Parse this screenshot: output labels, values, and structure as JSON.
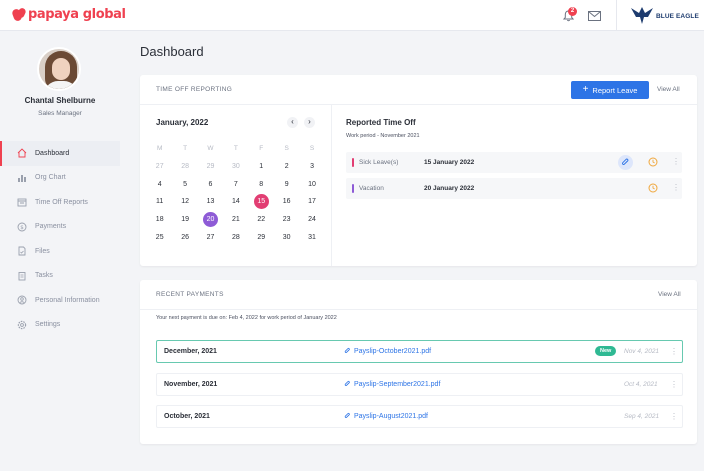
{
  "brand": {
    "name": "papaya global",
    "color": "#ef4150"
  },
  "header": {
    "notification_count": "2",
    "company_name": "BLUE EAGLE"
  },
  "user": {
    "name": "Chantal Shelburne",
    "role": "Sales Manager"
  },
  "sidebar": {
    "items": [
      {
        "label": "Dashboard",
        "icon": "home-icon",
        "active": true
      },
      {
        "label": "Org Chart",
        "icon": "org-chart-icon"
      },
      {
        "label": "Time Off Reports",
        "icon": "time-off-icon"
      },
      {
        "label": "Payments",
        "icon": "dollar-icon"
      },
      {
        "label": "Files",
        "icon": "file-icon"
      },
      {
        "label": "Tasks",
        "icon": "clipboard-icon"
      },
      {
        "label": "Personal Information",
        "icon": "person-icon"
      },
      {
        "label": "Settings",
        "icon": "gear-icon"
      }
    ]
  },
  "page_title": "Dashboard",
  "time_off": {
    "section_title": "TIME OFF REPORTING",
    "report_button": "Report Leave",
    "view_all": "View All",
    "calendar": {
      "month_label": "January, 2022",
      "prev": "‹",
      "next": "›",
      "weekdays": [
        "M",
        "T",
        "W",
        "T",
        "F",
        "S",
        "S"
      ],
      "days": [
        {
          "d": "27",
          "muted": true
        },
        {
          "d": "28",
          "muted": true
        },
        {
          "d": "29",
          "muted": true
        },
        {
          "d": "30",
          "muted": true
        },
        {
          "d": "1"
        },
        {
          "d": "2"
        },
        {
          "d": "3"
        },
        {
          "d": "4"
        },
        {
          "d": "5"
        },
        {
          "d": "6"
        },
        {
          "d": "7"
        },
        {
          "d": "8"
        },
        {
          "d": "9"
        },
        {
          "d": "10"
        },
        {
          "d": "11"
        },
        {
          "d": "12"
        },
        {
          "d": "13"
        },
        {
          "d": "14"
        },
        {
          "d": "15",
          "highlight": "#e23e73"
        },
        {
          "d": "16"
        },
        {
          "d": "17"
        },
        {
          "d": "18"
        },
        {
          "d": "19"
        },
        {
          "d": "20",
          "highlight": "#8e5bd6"
        },
        {
          "d": "21"
        },
        {
          "d": "22"
        },
        {
          "d": "23"
        },
        {
          "d": "24"
        },
        {
          "d": "25"
        },
        {
          "d": "26"
        },
        {
          "d": "27"
        },
        {
          "d": "28"
        },
        {
          "d": "29"
        },
        {
          "d": "30"
        },
        {
          "d": "31"
        }
      ]
    },
    "reported": {
      "title": "Reported Time Off",
      "work_period": "Work period - November 2021",
      "entries": [
        {
          "type": "Sick Leave(s)",
          "date": "15 January 2022",
          "color": "#e23e73",
          "attachment": true
        },
        {
          "type": "Vacation",
          "date": "20 January 2022",
          "color": "#8e5bd6",
          "attachment": false
        }
      ]
    }
  },
  "payments": {
    "section_title": "RECENT PAYMENTS",
    "view_all": "View All",
    "note": "Your next payment is due on: Feb 4, 2022 for work period of January 2022",
    "rows": [
      {
        "month": "December, 2021",
        "file": "Payslip-October2021.pdf",
        "badge": "New",
        "date": "Nov 4, 2021"
      },
      {
        "month": "November, 2021",
        "file": "Payslip-September2021.pdf",
        "badge": "",
        "date": "Oct 4, 2021"
      },
      {
        "month": "October, 2021",
        "file": "Payslip-August2021.pdf",
        "badge": "",
        "date": "Sep 4, 2021"
      }
    ]
  }
}
